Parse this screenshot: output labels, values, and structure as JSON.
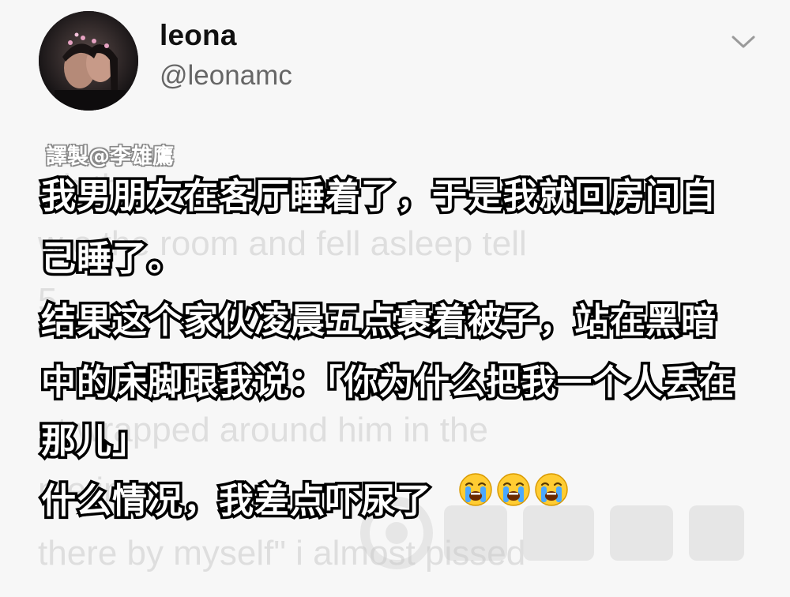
{
  "header": {
    "display_name": "leona",
    "handle": "@leonamc"
  },
  "credit": "譯製@李雄鷹",
  "ghost_text": {
    "line1": "wh                          the",
    "line2": "w    o the room and fell asleep tell",
    "line3": "                                   5",
    "line4": "                                    ",
    "line5": "     et wrapped around him in the",
    "line6": "                                       me in",
    "line7": "there by myself\" i almost pissed"
  },
  "subtitle": {
    "line1": "我男朋友在客厅睡着了，于是我就回房间自",
    "line2": "己睡了。",
    "line3": "结果这个家伙凌晨五点裹着被子，站在黑暗",
    "line4": "中的床脚跟我说：「你为什么把我一个人丢在",
    "line5": "那儿」",
    "line6": "什么情况，我差点吓尿了"
  },
  "icons": {
    "chevron": "chevron-down-icon",
    "emoji": "loudly-crying-face-emoji"
  },
  "colors": {
    "background": "#f7f7f7",
    "subtitle_fill": "#ffffff",
    "subtitle_stroke": "#000000",
    "handle": "#666666"
  }
}
